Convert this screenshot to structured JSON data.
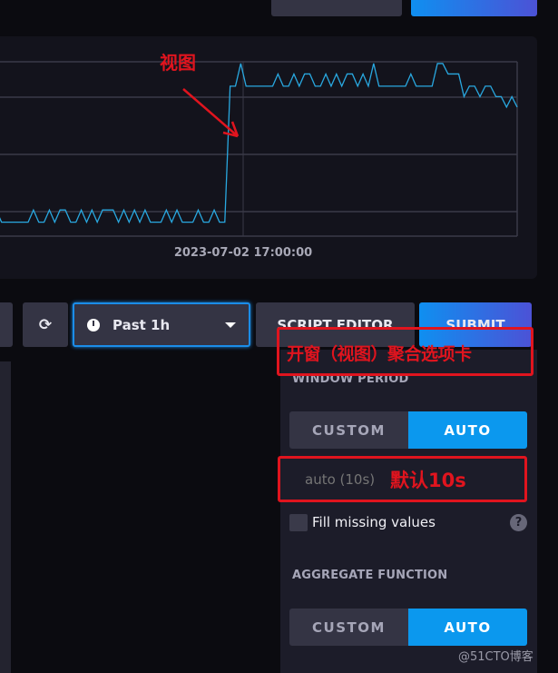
{
  "top_buttons": {
    "left": "",
    "right": ""
  },
  "annotations": {
    "view": "视图",
    "window_agg": "开窗（视图）聚合选项卡",
    "default": "默认10s"
  },
  "chart_data": {
    "type": "line",
    "title": "",
    "xlabel": "",
    "ylabel": "",
    "x_tick_labels": [
      "2023-07-02 17:00:00"
    ],
    "ylim": [
      0,
      100
    ],
    "grid": true,
    "color": "#29a8e0",
    "values": [
      8,
      15,
      8,
      8,
      8,
      8,
      8,
      8,
      15,
      8,
      8,
      15,
      8,
      15,
      15,
      8,
      8,
      15,
      8,
      15,
      8,
      15,
      15,
      15,
      8,
      15,
      8,
      15,
      8,
      15,
      8,
      8,
      8,
      15,
      8,
      15,
      8,
      8,
      8,
      15,
      8,
      8,
      15,
      8,
      8,
      86,
      86,
      99,
      86,
      86,
      86,
      86,
      86,
      86,
      93,
      86,
      86,
      93,
      86,
      93,
      93,
      86,
      86,
      93,
      86,
      93,
      86,
      93,
      93,
      86,
      93,
      86,
      99,
      86,
      86,
      86,
      86,
      86,
      86,
      93,
      86,
      86,
      86,
      86,
      99,
      99,
      93,
      93,
      93,
      80,
      86,
      86,
      80,
      86,
      86,
      80,
      80,
      74,
      80,
      74
    ]
  },
  "toolbar": {
    "time_range": "Past 1h",
    "script_editor": "SCRIPT EDITOR",
    "submit": "SUBMIT"
  },
  "window_period": {
    "label": "WINDOW PERIOD",
    "custom": "CUSTOM",
    "auto": "AUTO",
    "selected": "AUTO",
    "placeholder": "auto (10s)",
    "fill_missing": "Fill missing values",
    "fill_missing_checked": false,
    "help": "?"
  },
  "aggregate": {
    "label": "AGGREGATE FUNCTION",
    "custom": "CUSTOM",
    "auto": "AUTO",
    "selected": "AUTO"
  },
  "watermark": "@51CTO博客"
}
